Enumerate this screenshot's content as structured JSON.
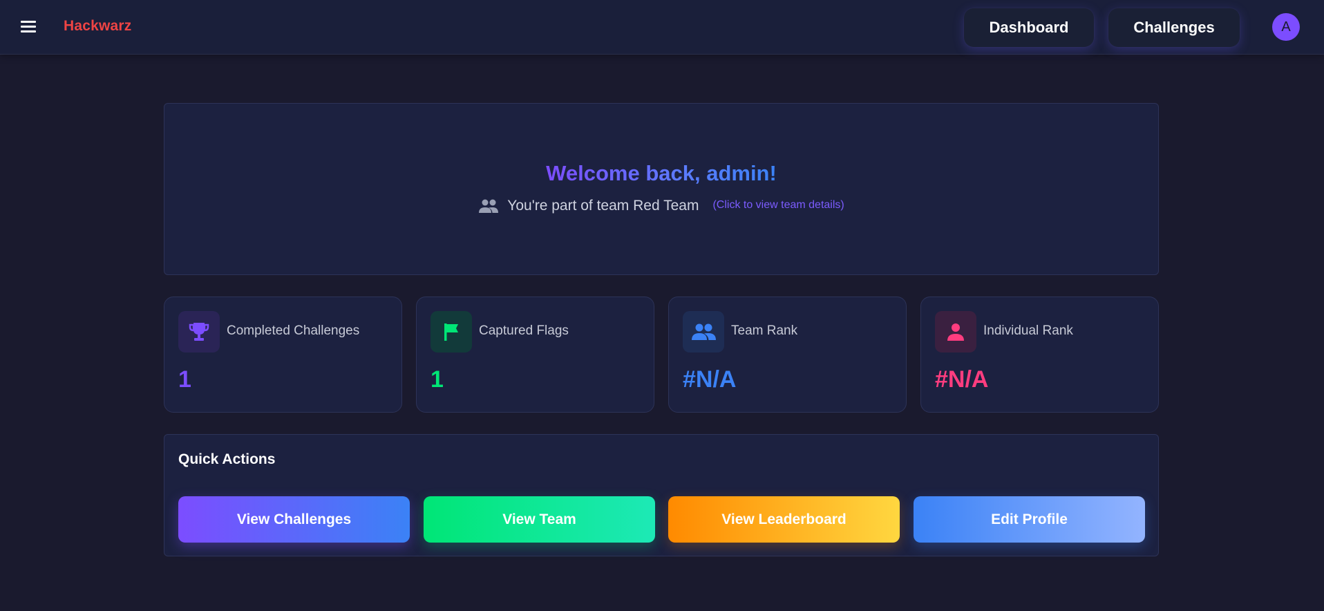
{
  "header": {
    "brand": "Hackwarz",
    "nav": {
      "dashboard": "Dashboard",
      "challenges": "Challenges"
    },
    "avatar_initial": "A"
  },
  "welcome": {
    "title": "Welcome back, admin!",
    "team_text": "You're part of team Red Team",
    "team_link": "(Click to view team details)"
  },
  "stats": [
    {
      "label": "Completed Challenges",
      "value": "1",
      "icon": "trophy-icon",
      "color": "#7c4dff",
      "bg": "#2a2456"
    },
    {
      "label": "Captured Flags",
      "value": "1",
      "icon": "flag-icon",
      "color": "#00e676",
      "bg": "#123a3a"
    },
    {
      "label": "Team Rank",
      "value": "#N/A",
      "icon": "group-icon",
      "color": "#3b82f6",
      "bg": "#1e2d54"
    },
    {
      "label": "Individual Rank",
      "value": "#N/A",
      "icon": "person-icon",
      "color": "#ff3d7f",
      "bg": "#3a2040"
    }
  ],
  "quick_actions": {
    "title": "Quick Actions",
    "buttons": [
      "View Challenges",
      "View Team",
      "View Leaderboard",
      "Edit Profile"
    ]
  },
  "colors": {
    "brand": "#ef4444",
    "accent_purple": "#7c4dff",
    "accent_green": "#00e676",
    "accent_blue": "#3b82f6",
    "accent_pink": "#ff3d7f",
    "accent_orange": "#ff8a00"
  }
}
